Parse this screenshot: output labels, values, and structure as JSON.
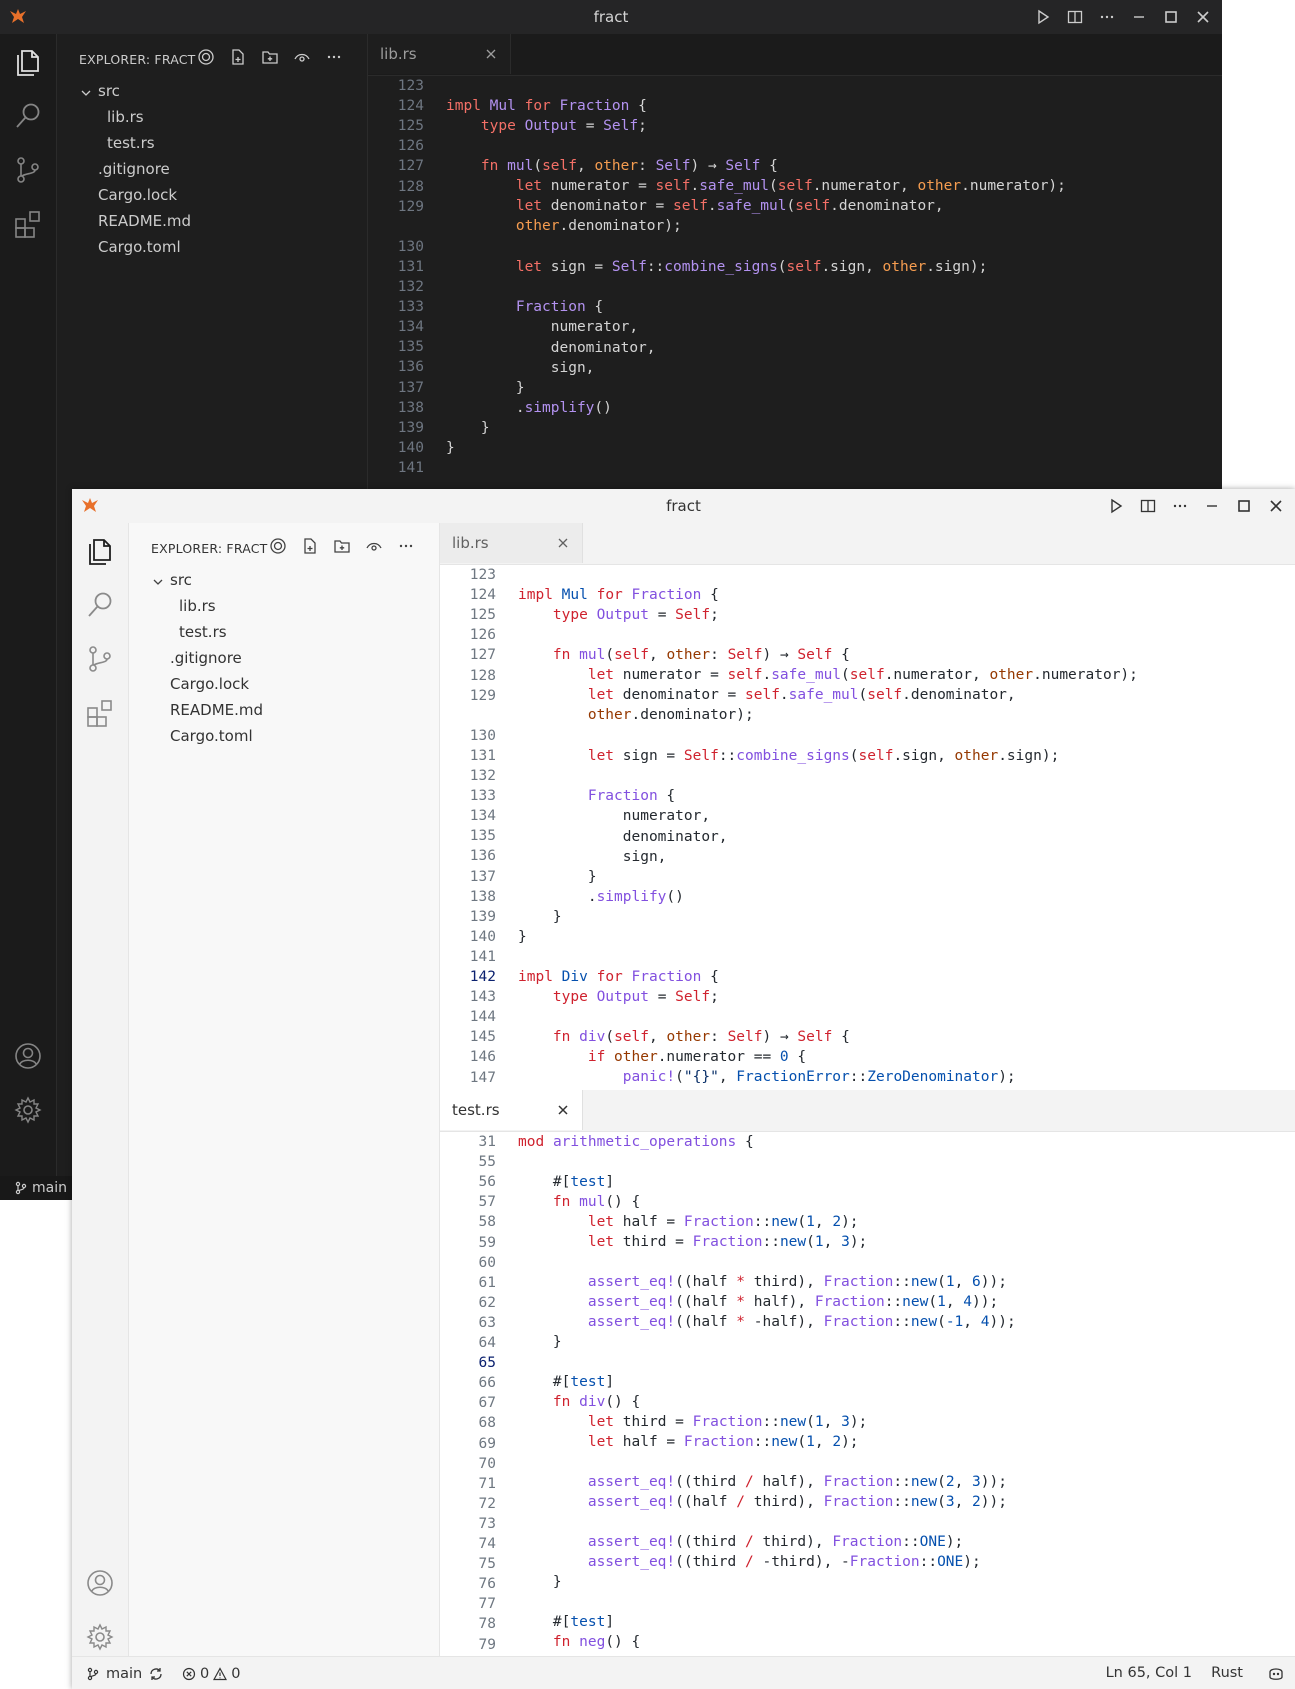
{
  "dark_window": {
    "title": "fract",
    "explorer": {
      "header": "EXPLORER: FRACT",
      "tree": [
        {
          "label": "src",
          "kind": "folder"
        },
        {
          "label": "lib.rs",
          "kind": "file"
        },
        {
          "label": "test.rs",
          "kind": "file"
        },
        {
          "label": ".gitignore",
          "kind": "file"
        },
        {
          "label": "Cargo.lock",
          "kind": "file"
        },
        {
          "label": "README.md",
          "kind": "file"
        },
        {
          "label": "Cargo.toml",
          "kind": "file"
        }
      ]
    },
    "tab": {
      "label": "lib.rs"
    },
    "status_branch": "main",
    "line_numbers": [
      "123",
      "124",
      "125",
      "126",
      "127",
      "128",
      "129",
      "",
      "130",
      "131",
      "132",
      "133",
      "134",
      "135",
      "136",
      "137",
      "138",
      "139",
      "140",
      "141"
    ]
  },
  "light_window": {
    "title": "fract",
    "explorer": {
      "header": "EXPLORER: FRACT",
      "tree": [
        {
          "label": "src",
          "kind": "folder"
        },
        {
          "label": "lib.rs",
          "kind": "file"
        },
        {
          "label": "test.rs",
          "kind": "file"
        },
        {
          "label": ".gitignore",
          "kind": "file"
        },
        {
          "label": "Cargo.lock",
          "kind": "file"
        },
        {
          "label": "README.md",
          "kind": "file"
        },
        {
          "label": "Cargo.toml",
          "kind": "file"
        }
      ]
    },
    "top_pane": {
      "tab": {
        "label": "lib.rs"
      },
      "line_numbers": [
        "123",
        "124",
        "125",
        "126",
        "127",
        "128",
        "129",
        "",
        "130",
        "131",
        "132",
        "133",
        "134",
        "135",
        "136",
        "137",
        "138",
        "139",
        "140",
        "141",
        "142",
        "143",
        "144",
        "145",
        "146",
        "147"
      ],
      "current_line": "142"
    },
    "bottom_pane": {
      "tab": {
        "label": "test.rs"
      },
      "line_numbers": [
        "31",
        "55",
        "56",
        "57",
        "58",
        "59",
        "60",
        "61",
        "62",
        "63",
        "64",
        "65",
        "66",
        "67",
        "68",
        "69",
        "70",
        "71",
        "72",
        "73",
        "74",
        "75",
        "76",
        "77",
        "78",
        "79"
      ],
      "current_line": "65"
    },
    "status_bar": {
      "branch": "main",
      "errors": "0",
      "warnings": "0",
      "cursor": "Ln 65, Col 1",
      "language": "Rust"
    }
  },
  "colors": {
    "accent_logo": "#e8702a",
    "dark_bg": "#1e1e1e",
    "light_bg": "#ffffff",
    "keyword_dark": "#f47067",
    "keyword_light": "#cf222e",
    "type_light": "#8250df",
    "number_light": "#0550ae"
  },
  "icons": [
    "logo-icon",
    "play-icon",
    "split-editor-icon",
    "more-icon",
    "minimize-icon",
    "maximize-icon",
    "close-icon",
    "files-icon",
    "search-icon",
    "source-control-icon",
    "extensions-icon",
    "account-icon",
    "settings-icon",
    "chevron-down-icon",
    "git-branch-icon",
    "sync-icon",
    "error-icon",
    "warning-icon",
    "copilot-icon"
  ]
}
